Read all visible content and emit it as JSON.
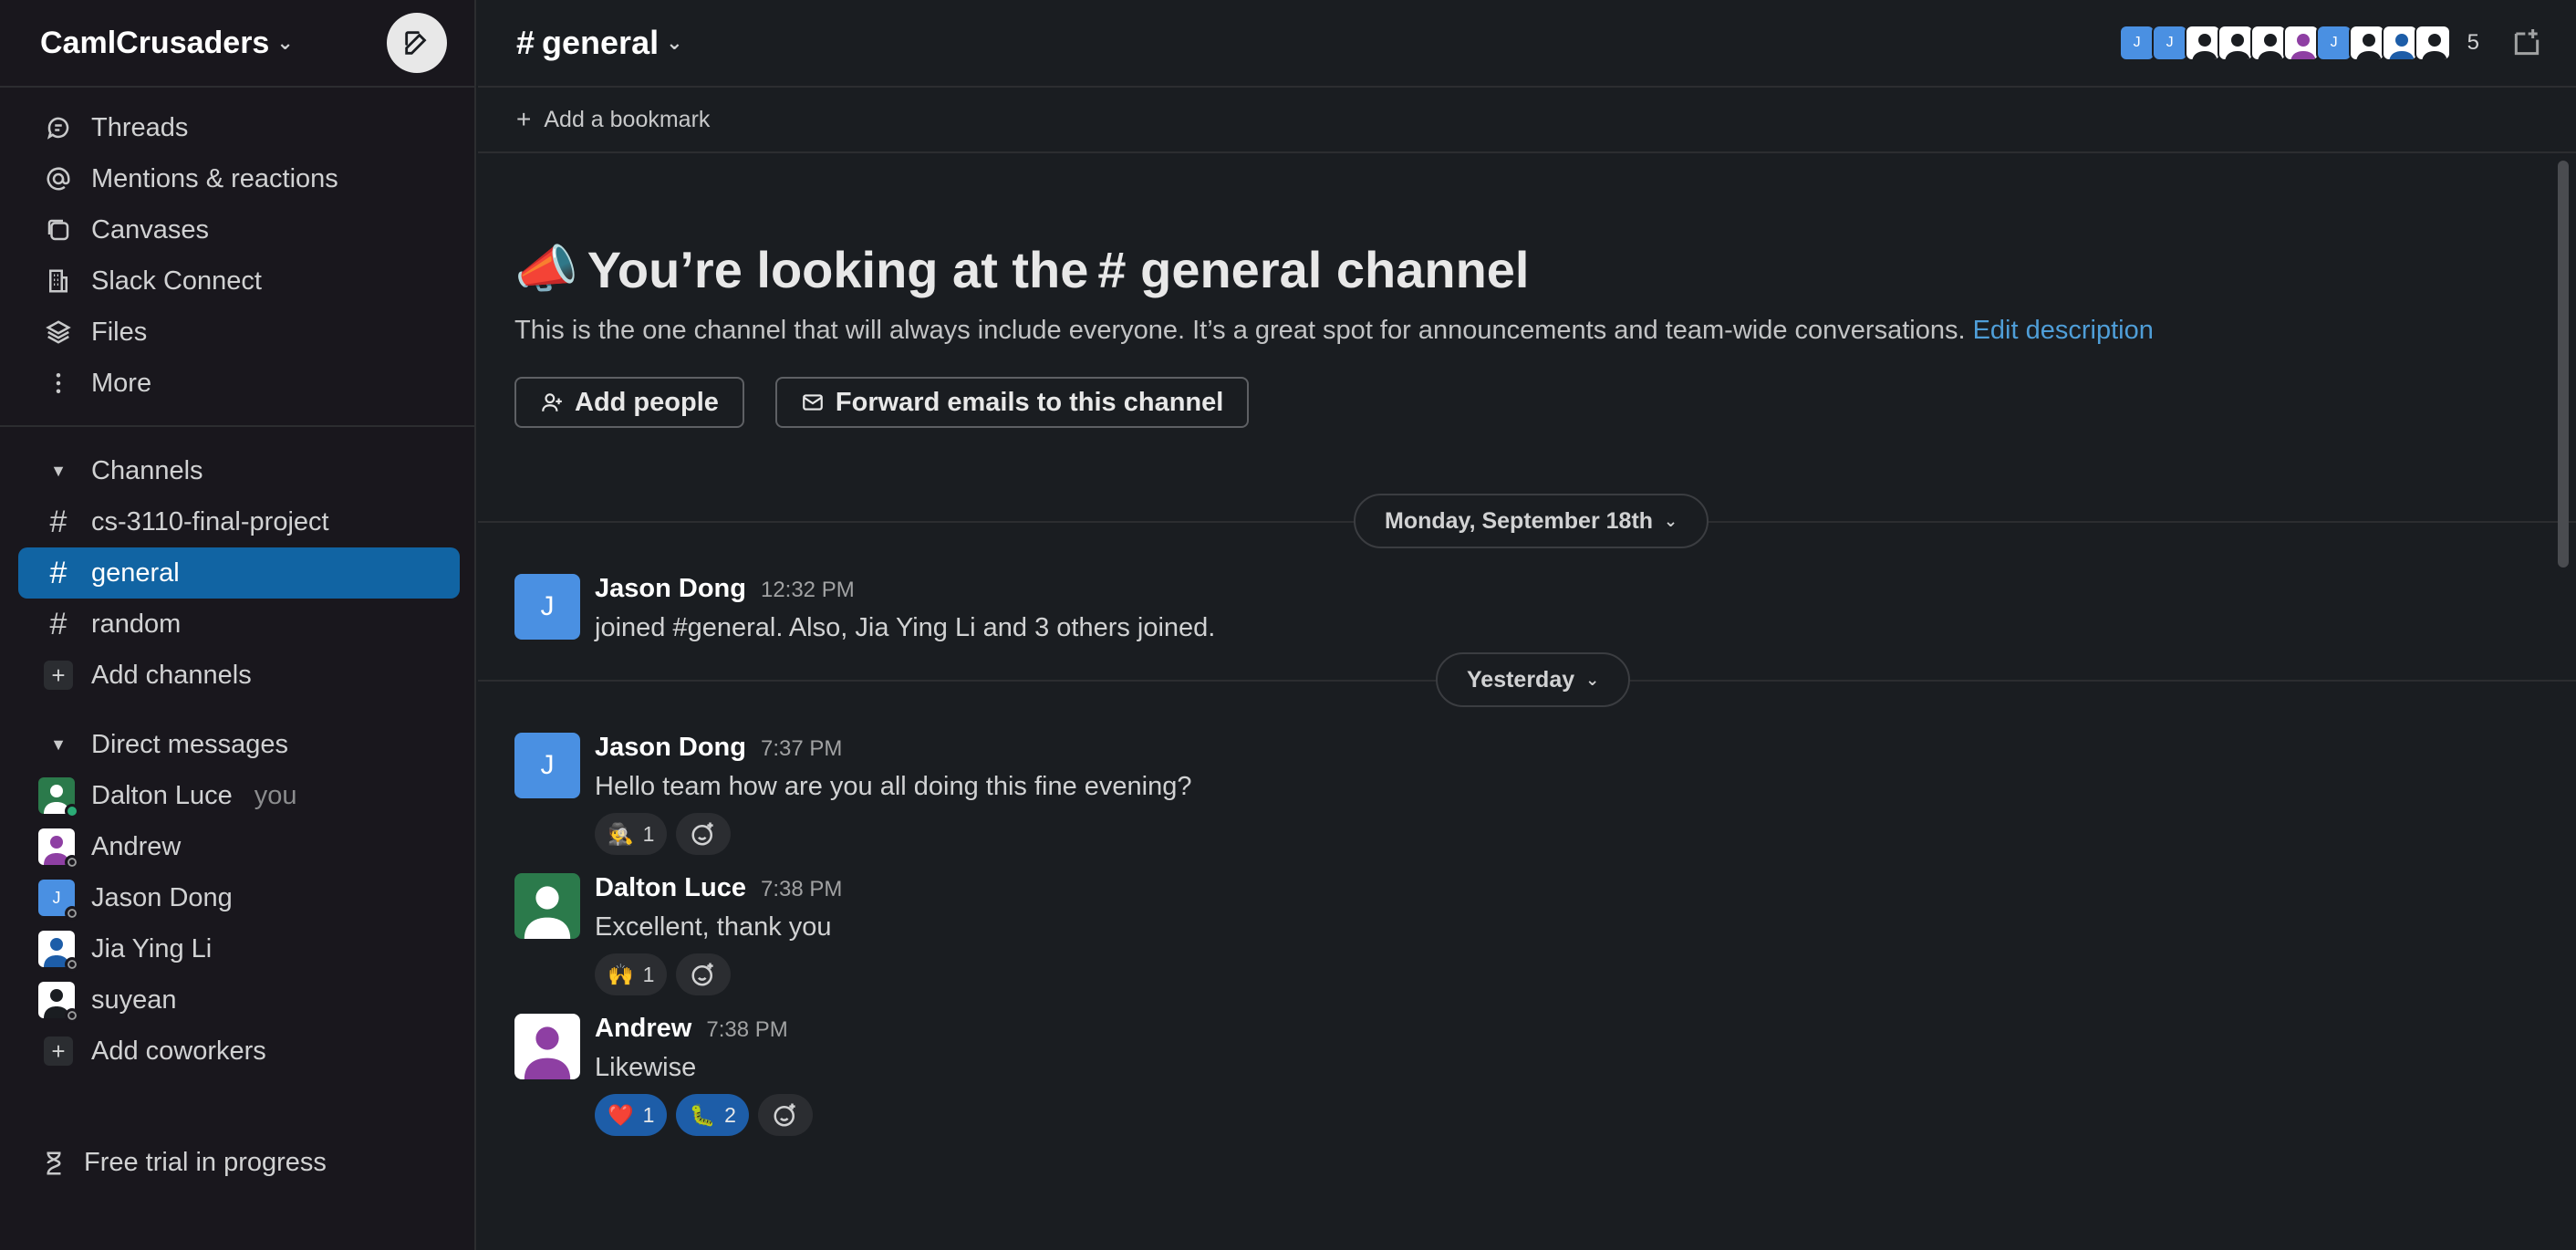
{
  "workspace": {
    "name": "CamlCrusaders"
  },
  "sidebar": {
    "nav": [
      {
        "label": "Threads",
        "icon": "threads-icon"
      },
      {
        "label": "Mentions & reactions",
        "icon": "at-icon"
      },
      {
        "label": "Canvases",
        "icon": "canvases-icon"
      },
      {
        "label": "Slack Connect",
        "icon": "building-icon"
      },
      {
        "label": "Files",
        "icon": "layers-icon"
      },
      {
        "label": "More",
        "icon": "more-vertical-icon"
      }
    ],
    "channels_header": "Channels",
    "channels": [
      {
        "name": "cs-3110-final-project"
      },
      {
        "name": "general",
        "active": true
      },
      {
        "name": "random"
      }
    ],
    "add_channels": "Add channels",
    "dms_header": "Direct messages",
    "dms": [
      {
        "name": "Dalton Luce",
        "suffix": "you",
        "status": "online"
      },
      {
        "name": "Andrew",
        "status": "away"
      },
      {
        "name": "Jason Dong",
        "status": "away"
      },
      {
        "name": "Jia Ying Li",
        "status": "away"
      },
      {
        "name": "suyean",
        "status": "away"
      }
    ],
    "add_coworkers": "Add coworkers",
    "free_trial": "Free trial in progress"
  },
  "channel": {
    "hash": "#",
    "name": "general",
    "member_count": "5",
    "bookmark_label": "Add a bookmark"
  },
  "intro": {
    "emoji": "📣",
    "title_prefix": "You’re looking at the",
    "title_channel": "# general channel",
    "description": "This is the one channel that will always include everyone. It’s a great spot for announcements and team-wide conversations.",
    "edit_link": "Edit description",
    "add_people": "Add people",
    "forward_emails": "Forward emails to this channel"
  },
  "dividers": {
    "first": "Monday, September 18th",
    "second": "Yesterday"
  },
  "messages": [
    {
      "author": "Jason Dong",
      "time": "12:32 PM",
      "text": "joined #general. Also, Jia Ying Li and 3 others joined.",
      "avatar_letter": "J"
    },
    {
      "author": "Jason Dong",
      "time": "7:37 PM",
      "text": "Hello team how are you all doing this fine evening?",
      "avatar_letter": "J",
      "reactions": [
        {
          "emoji": "🕵",
          "count": "1"
        }
      ]
    },
    {
      "author": "Dalton Luce",
      "time": "7:38 PM",
      "text": "Excellent, thank you",
      "reactions": [
        {
          "emoji": "🙌",
          "count": "1"
        }
      ]
    },
    {
      "author": "Andrew",
      "time": "7:38 PM",
      "text": "Likewise",
      "reactions": [
        {
          "emoji": "❤️",
          "count": "1"
        },
        {
          "emoji": "🐛",
          "count": "2"
        }
      ]
    }
  ],
  "colors": {
    "accent": "#1164a3",
    "link": "#4f9ed8",
    "avatar_blue": "#4a90e2",
    "avatar_green": "#2b7a4b",
    "avatar_purple": "#8e3fa3"
  }
}
